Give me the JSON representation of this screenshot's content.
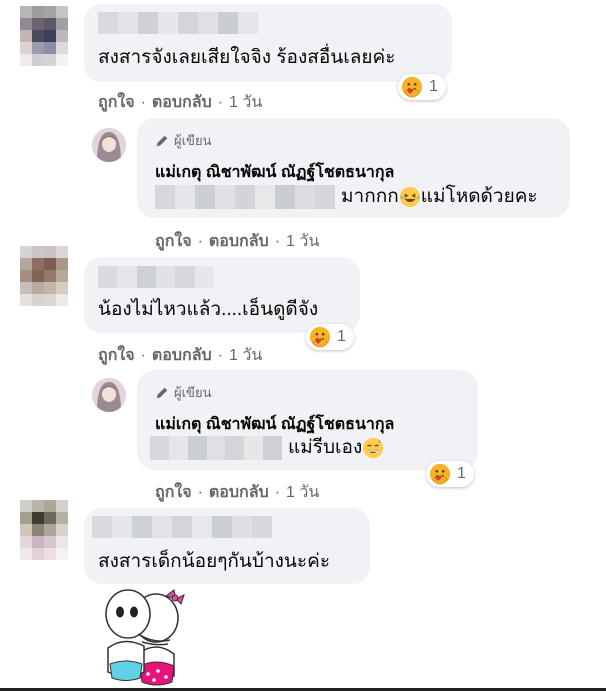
{
  "labels": {
    "like": "ถูกใจ",
    "reply": "ตอบกลับ",
    "time": "1 วัน",
    "author_badge": "ผู้เขียน",
    "sep": "·"
  },
  "comments": [
    {
      "text": "สงสารจังเลยเสียใจจิง ร้องสอื่นเลยค่ะ",
      "reaction_count": "1",
      "reply": {
        "author": "แม่เกตุ ณิชาพัฒน์ ณัฏฐ์โชตธนากุล",
        "text": "มากกก",
        "text_after": "แม่โหดด้วยคะ"
      }
    },
    {
      "text": "น้องไม่ไหวแล้ว....เอ็นดูดีจัง",
      "reaction_count": "1",
      "reply": {
        "author": "แม่เกตุ ณิชาพัฒน์ ณัฏฐ์โชตธนากุล",
        "text": "แม่รีบเอง",
        "reaction_count": "1"
      }
    },
    {
      "text": "สงสารเด็กน้อยๆกันบ้างนะค่ะ"
    }
  ],
  "colors": {
    "bubble": "#f0f2f5",
    "meta": "#65676b",
    "text": "#050505"
  },
  "icons": [
    "care-reaction-icon",
    "pencil-icon",
    "laughing-tears-emoji",
    "sweat-smile-emoji",
    "hug-sticker"
  ]
}
